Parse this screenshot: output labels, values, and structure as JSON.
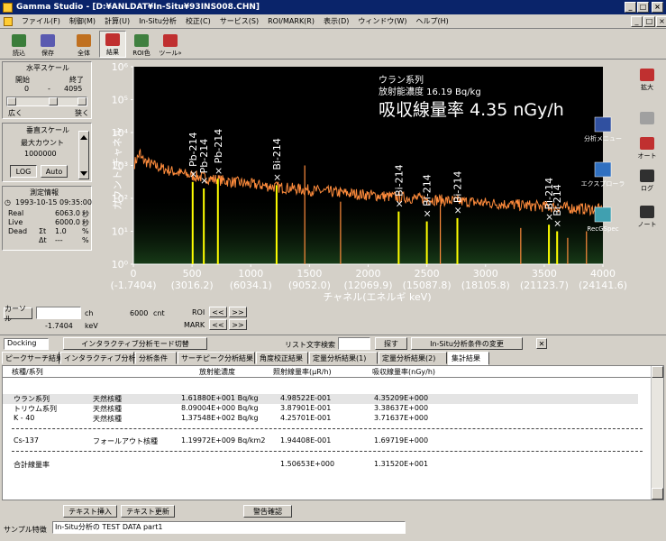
{
  "app": {
    "title": "Gamma Studio - [D:¥ANLDAT¥In-Situ¥93INS008.CHN]"
  },
  "menu": [
    "ファイル(F)",
    "制御(M)",
    "計算(U)",
    "In-Situ分析",
    "校正(C)",
    "サービス(S)",
    "ROI/MARK(R)",
    "表示(D)",
    "ウィンドウ(W)",
    "ヘルプ(H)"
  ],
  "toolbar": [
    {
      "label": "読込",
      "icon": "open-file-icon"
    },
    {
      "label": "保存",
      "icon": "save-icon"
    },
    {
      "label": "全体",
      "icon": "full-view-icon"
    },
    {
      "label": "結果",
      "icon": "alt-result-icon"
    },
    {
      "label": "ROI色",
      "icon": "roi-color-icon"
    },
    {
      "label": "ツール»",
      "icon": "tool-icon"
    }
  ],
  "horizontal_scale": {
    "title": "水平スケール",
    "start_label": "開始",
    "end_label": "終了",
    "start": "0",
    "dash": "-",
    "end": "4095",
    "wide": "広く",
    "narrow": "狭く"
  },
  "vertical_scale": {
    "title": "垂直スケール",
    "max_count_label": "最大カウント",
    "max_count": "1000000",
    "log": "LOG",
    "auto": "Auto"
  },
  "measurement": {
    "title": "測定情報",
    "datetime": "1993-10-15 09:35:00",
    "rows": [
      {
        "label": "Real",
        "mid": "",
        "value": "6063.0",
        "unit": "秒"
      },
      {
        "label": "Live",
        "mid": "",
        "value": "6000.0",
        "unit": "秒"
      },
      {
        "label": "Dead",
        "mid": "Σt",
        "value": "1.0",
        "unit": "%"
      },
      {
        "label": "",
        "mid": "Δt",
        "value": "---",
        "unit": "%"
      }
    ]
  },
  "chart_data": {
    "type": "line",
    "ylabel": "カウント/チャネル",
    "xlabel": "チャネル(エネルギ keV)",
    "ylim_log10": [
      0,
      6
    ],
    "y_tick_labels": [
      "10⁰",
      "10¹",
      "10²",
      "10³",
      "10⁴",
      "10⁵",
      "10⁶"
    ],
    "xlim": [
      0,
      4000
    ],
    "x_ticks": [
      0,
      500,
      1000,
      1500,
      2000,
      2500,
      3000,
      3500,
      4000
    ],
    "x_energy_labels": [
      "(-1.7404)",
      "(3016.2)",
      "(6034.1)",
      "(9052.0)",
      "(12069.9)",
      "(15087.8)",
      "(18105.8)",
      "(21123.7)",
      "(24141.6)"
    ],
    "peaks": [
      {
        "name": "× Pb-214",
        "channel": 505
      },
      {
        "name": "× Pb-214",
        "channel": 600
      },
      {
        "name": "× Pb-214",
        "channel": 720
      },
      {
        "name": "× Bi-214",
        "channel": 1220
      },
      {
        "name": "× Bi-214",
        "channel": 2260
      },
      {
        "name": "× Bi-214",
        "channel": 2500
      },
      {
        "name": "× Bi-214",
        "channel": 2760
      },
      {
        "name": "× Bi-214",
        "channel": 3540
      },
      {
        "name": "× Bi-214",
        "channel": 3610
      }
    ],
    "overlay": {
      "series": "ウラン系列",
      "activity": "放射能濃度 16.19 Bq/kg",
      "dose": "吸収線量率 4.35 nGy/h"
    }
  },
  "right_tools": [
    {
      "label": "拡大",
      "icon": "zoom-in-icon"
    },
    {
      "label": "",
      "icon": "zoom-out-icon"
    },
    {
      "label": "オート",
      "icon": "auto-icon"
    },
    {
      "label": "ログ",
      "icon": "log-icon"
    },
    {
      "label": "ノート",
      "icon": "note-icon"
    }
  ],
  "plot_icons": [
    {
      "label": "分析メニュー",
      "icon": "analysis-menu-icon"
    },
    {
      "label": "エクスプローラ",
      "icon": "explorer-icon"
    },
    {
      "label": "RecGSpec",
      "icon": "recgspec-icon"
    }
  ],
  "cursor": {
    "label": "カーソル",
    "ch_label": "ch",
    "ch_value": "6000",
    "cnt": "cnt",
    "kev_value": "-1.7404",
    "kev": "keV",
    "roi": "ROI",
    "mark": "MARK",
    "prev": "<<",
    "next": ">>"
  },
  "bar": {
    "docking": "Docking",
    "interactive_switch": "インタラクティブ分析モード切替",
    "list_search": "リスト文字検索",
    "search": "探す",
    "change_cond": "In-Situ分析条件の変更",
    "close": "✕"
  },
  "tabs": [
    "ピークサーチ結果",
    "インタラクティブ分析結果",
    "分析条件",
    "サーチピーク分析結果",
    "角度校正結果",
    "定量分析結果(1)",
    "定量分析結果(2)",
    "集計結果"
  ],
  "table": {
    "headers": [
      "核種/系列",
      "放射能濃度",
      "照射線量率(μR/h)",
      "吸収線量率(nGy/h)"
    ],
    "rows": [
      {
        "name": "ウラン系列",
        "type": "天然核種",
        "conc": "1.61880E+001 Bq/kg",
        "exp": "4.98522E-001",
        "abs": "4.35209E+000"
      },
      {
        "name": "トリウム系列",
        "type": "天然核種",
        "conc": "8.09004E+000 Bq/kg",
        "exp": "3.87901E-001",
        "abs": "3.38637E+000"
      },
      {
        "name": "K - 40",
        "type": "天然核種",
        "conc": "1.37548E+002 Bq/kg",
        "exp": "4.25701E-001",
        "abs": "3.71637E+000"
      },
      {
        "name": "Cs-137",
        "type": "フォールアウト核種",
        "conc": "1.19972E+009 Bq/km2",
        "exp": "1.94408E-001",
        "abs": "1.69719E+000"
      },
      {
        "name": "合計線量率",
        "type": "",
        "conc": "",
        "exp": "1.50653E+000",
        "abs": "1.31520E+001"
      }
    ]
  },
  "bottom": {
    "insert_text": "テキスト挿入",
    "update_text": "テキスト更新",
    "warning": "警告確認",
    "sample_label": "サンプル特徴",
    "sample_value": "In-Situ分析の TEST DATA part1"
  },
  "colors": {
    "plot_bg": "#000000",
    "spectrum": "#ff8c3c",
    "peak": "#ffff00",
    "titlebar": "#0a246a"
  }
}
